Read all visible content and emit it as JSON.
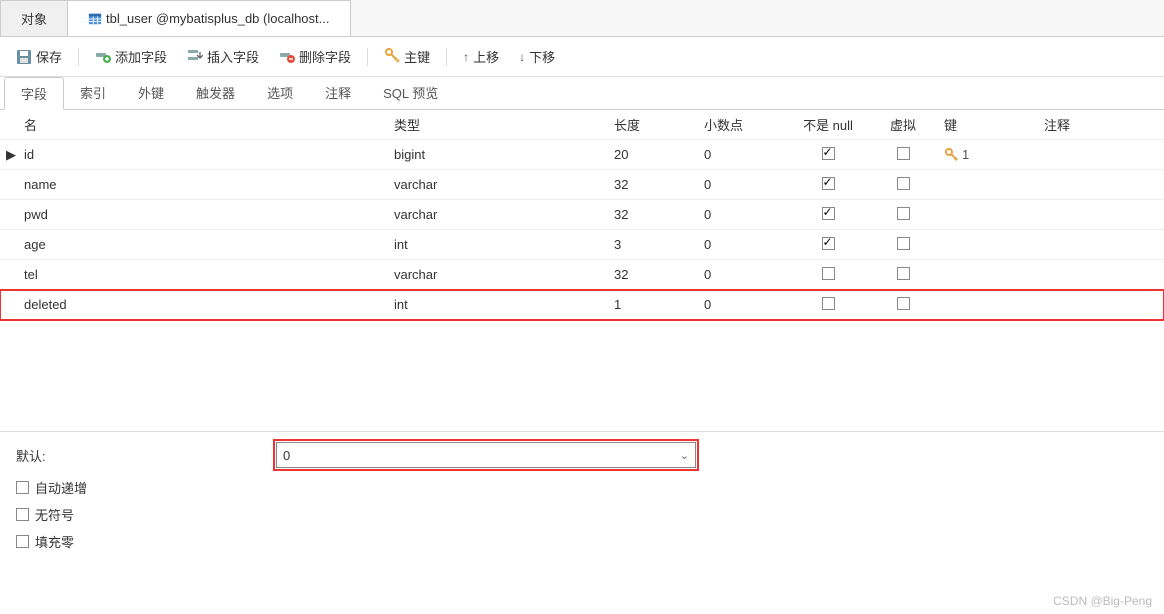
{
  "topTabs": {
    "obj": "对象",
    "table": "tbl_user @mybatisplus_db (localhost..."
  },
  "toolbar": {
    "save": "保存",
    "addField": "添加字段",
    "insertField": "插入字段",
    "deleteField": "删除字段",
    "primaryKey": "主键",
    "moveUp": "上移",
    "moveDown": "下移"
  },
  "subtabs": {
    "fields": "字段",
    "indexes": "索引",
    "fk": "外键",
    "trigger": "触发器",
    "options": "选项",
    "comment": "注释",
    "sql": "SQL 预览"
  },
  "grid": {
    "headers": {
      "name": "名",
      "type": "类型",
      "len": "长度",
      "dec": "小数点",
      "nn": "不是 null",
      "virt": "虚拟",
      "key": "键",
      "comment": "注释"
    },
    "rows": [
      {
        "marker": "▶",
        "name": "id",
        "type": "bigint",
        "len": "20",
        "dec": "0",
        "nn": true,
        "virt": false,
        "key": "1",
        "hasKey": true
      },
      {
        "marker": "",
        "name": "name",
        "type": "varchar",
        "len": "32",
        "dec": "0",
        "nn": true,
        "virt": false,
        "key": "",
        "hasKey": false
      },
      {
        "marker": "",
        "name": "pwd",
        "type": "varchar",
        "len": "32",
        "dec": "0",
        "nn": true,
        "virt": false,
        "key": "",
        "hasKey": false
      },
      {
        "marker": "",
        "name": "age",
        "type": "int",
        "len": "3",
        "dec": "0",
        "nn": true,
        "virt": false,
        "key": "",
        "hasKey": false
      },
      {
        "marker": "",
        "name": "tel",
        "type": "varchar",
        "len": "32",
        "dec": "0",
        "nn": false,
        "virt": false,
        "key": "",
        "hasKey": false
      },
      {
        "marker": "",
        "name": "deleted",
        "type": "int",
        "len": "1",
        "dec": "0",
        "nn": false,
        "virt": false,
        "key": "",
        "hasKey": false,
        "highlight": true
      }
    ]
  },
  "props": {
    "defaultLabel": "默认:",
    "defaultValue": "0",
    "autoInc": "自动递增",
    "unsigned": "无符号",
    "zerofill": "填充零"
  },
  "watermark": "CSDN @Big-Peng"
}
